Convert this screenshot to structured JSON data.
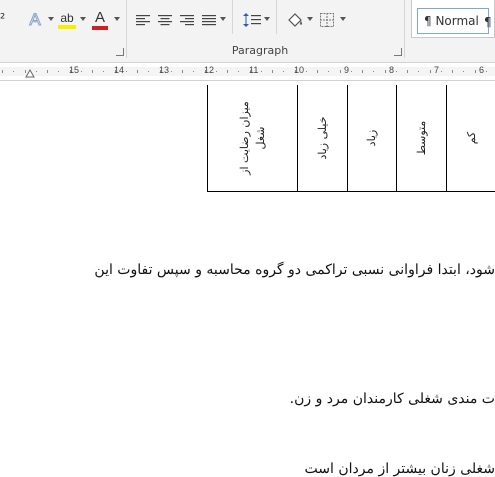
{
  "ribbon": {
    "paragraph_group_label": "Paragraph",
    "styles": {
      "normal_label": "¶ Normal",
      "next_label": "¶"
    },
    "font_color_letter": "A",
    "text_effect_letter": "A",
    "highlight_letters": "ab",
    "colors": {
      "highlight": "#f5f000",
      "font_color": "#d01f1f",
      "normal_border": "#7ea8d8"
    }
  },
  "ruler": {
    "numbers": [
      "15",
      "14",
      "13",
      "12",
      "11",
      "10",
      "9",
      "8",
      "7",
      "6"
    ]
  },
  "document": {
    "table_headers": [
      "میزان رضایت از شغل",
      "خیلی زیاد",
      "زیاد",
      "متوسط",
      "کم"
    ],
    "paragraph_1": "شود، ابتدا فراوانی نسبی تراکمی دو گروه محاسبه و سپس تفاوت این",
    "paragraph_2": "ت مندی شغلی کارمندان مرد و زن.",
    "paragraph_3": "شغلی زنان بیشتر از مردان است"
  }
}
